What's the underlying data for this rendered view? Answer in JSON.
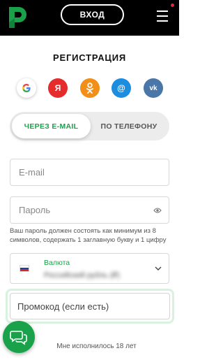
{
  "header": {
    "login_label": "ВХОД",
    "logo_icon": "brand-logo-icon",
    "menu_icon": "hamburger-menu-icon",
    "notification_dot_color": "#e0283a"
  },
  "page": {
    "title": "РЕГИСТРАЦИЯ"
  },
  "socials": [
    {
      "name": "google",
      "icon": "google-icon",
      "glyph": "G"
    },
    {
      "name": "yandex",
      "icon": "yandex-icon",
      "glyph": "Я",
      "color": "#e52b2b"
    },
    {
      "name": "odnoklassniki",
      "icon": "ok-icon",
      "glyph": "ок",
      "color": "#f18f19"
    },
    {
      "name": "mail",
      "icon": "mail-at-icon",
      "glyph": "@",
      "color": "#1d8de0"
    },
    {
      "name": "vk",
      "icon": "vk-icon",
      "glyph": "vk",
      "color": "#4a76a8"
    }
  ],
  "tabs": [
    {
      "label": "ЧЕРЕЗ E-MAIL",
      "active": true
    },
    {
      "label": "ПО ТЕЛЕФОНУ",
      "active": false
    }
  ],
  "form": {
    "email_placeholder": "E-mail",
    "password_placeholder": "Пароль",
    "password_hint": "Ваш пароль должен состоять как минимум из 8 символов, содержать 1 заглавную букву и 1 цифру",
    "currency_label": "Валюта",
    "currency_value": "Российский рубль (₽)",
    "promo_placeholder": "Промокод (если есть)",
    "age_text": "Мне исполнилось 18 лет"
  },
  "colors": {
    "accent": "#1aa24b",
    "header_bg": "#000000"
  }
}
